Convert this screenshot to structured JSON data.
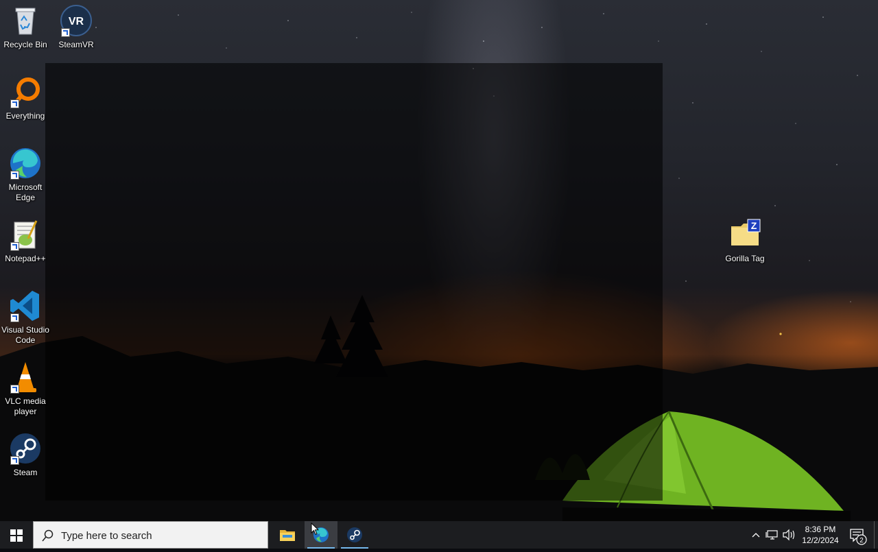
{
  "desktop": {
    "icons": [
      {
        "label": "Recycle Bin",
        "icon": "recycle-bin-icon"
      },
      {
        "label": "SteamVR",
        "icon": "steamvr-icon",
        "badge": "VR"
      },
      {
        "label": "Everything",
        "icon": "everything-search-icon"
      },
      {
        "label": "Microsoft Edge",
        "icon": "edge-icon"
      },
      {
        "label": "Notepad++",
        "icon": "notepad-plus-plus-icon"
      },
      {
        "label": "Visual Studio Code",
        "icon": "vscode-icon"
      },
      {
        "label": "VLC media player",
        "icon": "vlc-icon"
      },
      {
        "label": "Steam",
        "icon": "steam-icon"
      },
      {
        "label": "Gorilla Tag",
        "icon": "zip-folder-icon",
        "badge": "Z"
      }
    ]
  },
  "taskbar": {
    "start_icon": "windows-logo-icon",
    "search_placeholder": "Type here to search",
    "pinned": [
      {
        "name": "File Explorer",
        "icon": "folder-icon",
        "active": false
      },
      {
        "name": "Microsoft Edge",
        "icon": "edge-icon",
        "active": true
      },
      {
        "name": "Steam",
        "icon": "steam-icon",
        "active": false
      }
    ],
    "tray": {
      "time": "8:36 PM",
      "date": "12/2/2024",
      "notification_count": "2"
    }
  },
  "colors": {
    "taskbar_bg": "#1c1d20",
    "accent": "#76b9ed",
    "tent_green": "#7fc42a"
  }
}
